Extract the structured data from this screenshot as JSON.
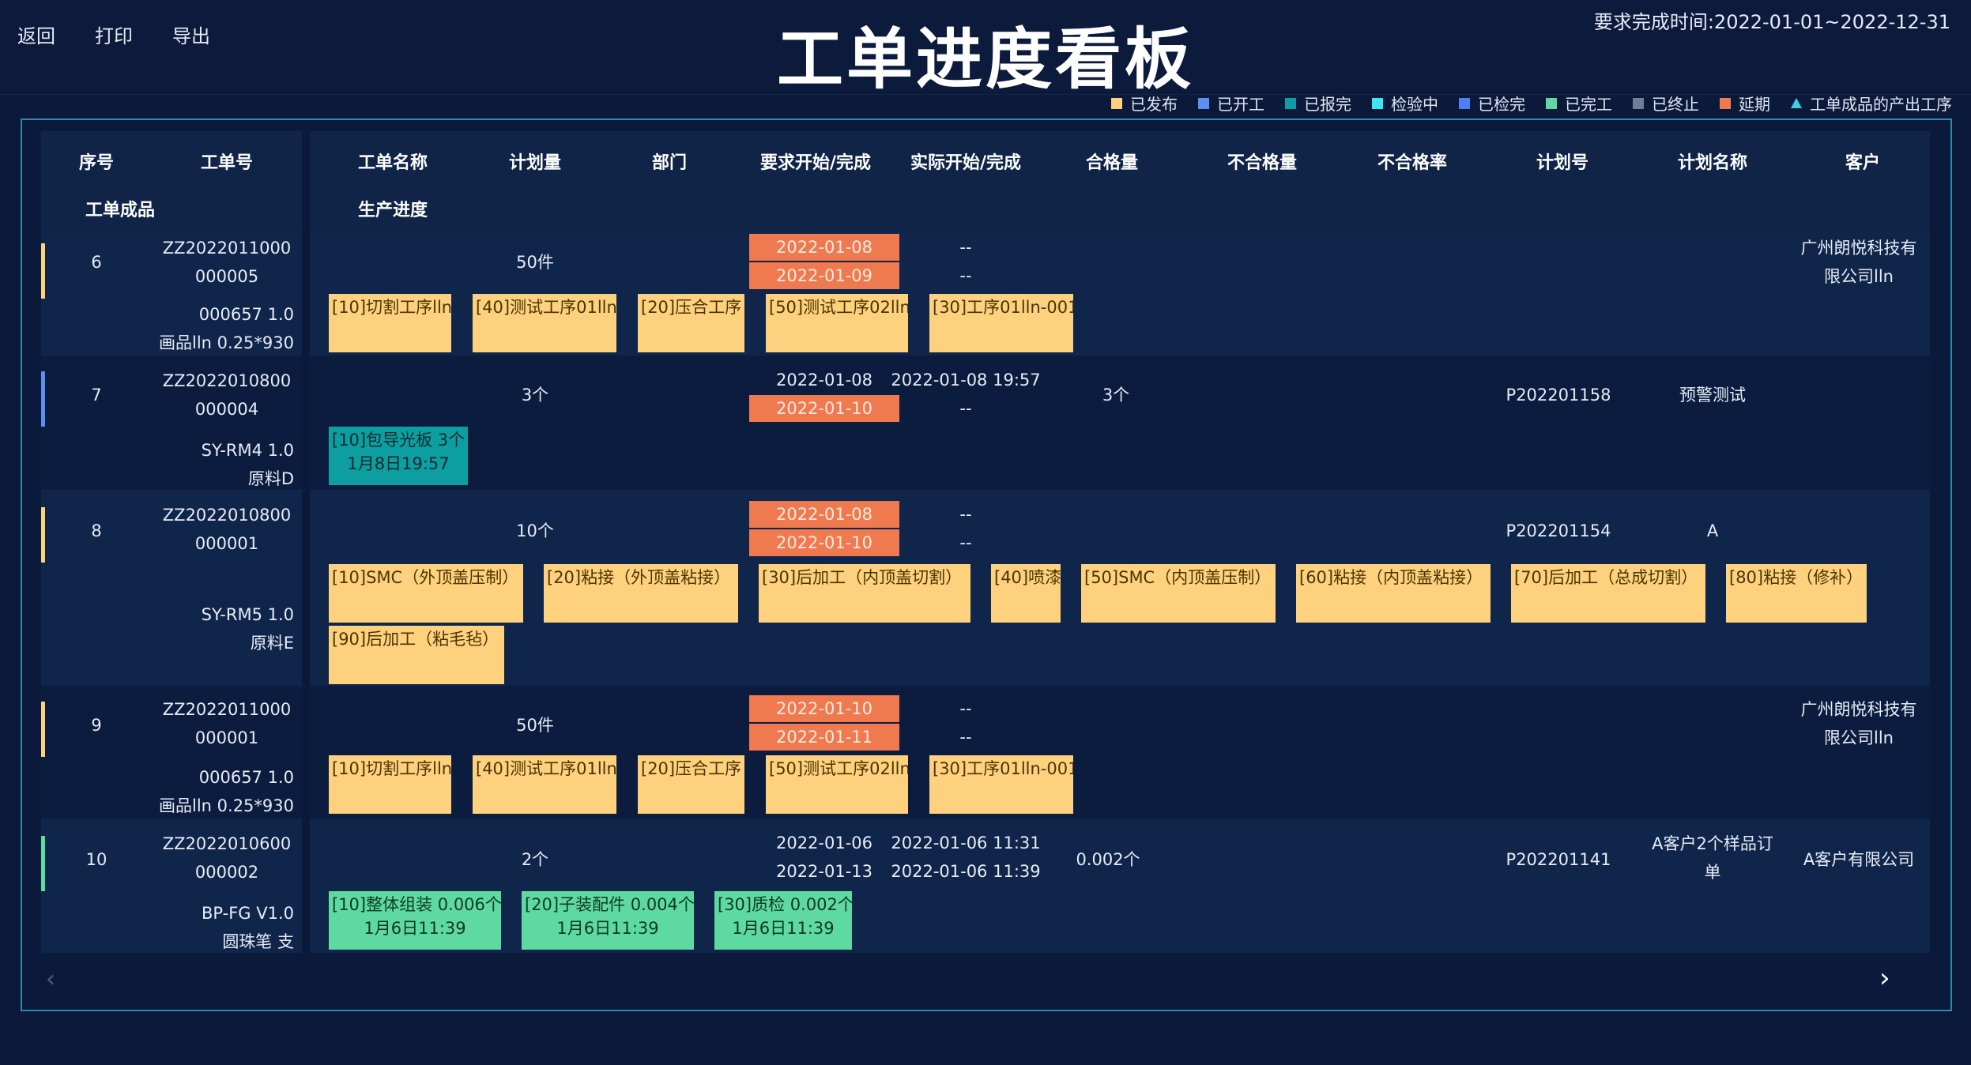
{
  "header": {
    "nav": [
      "返回",
      "打印",
      "导出"
    ],
    "title": "工单进度看板",
    "due_range": "要求完成时间:2022-01-01~2022-12-31"
  },
  "legend": [
    {
      "label": "已发布",
      "color": "#fdd17e"
    },
    {
      "label": "已开工",
      "color": "#5b8ff0"
    },
    {
      "label": "已报完",
      "color": "#0c9ea1"
    },
    {
      "label": "检验中",
      "color": "#3ae6f0"
    },
    {
      "label": "已检完",
      "color": "#4f7ff5"
    },
    {
      "label": "已完工",
      "color": "#5fd9a2"
    },
    {
      "label": "已终止",
      "color": "#6f7d96"
    },
    {
      "label": "延期",
      "color": "#ef7a4f"
    },
    {
      "label": "工单成品的产出工序",
      "color": "#3ad1e8"
    }
  ],
  "columns": {
    "seq": "序号",
    "wo_no": "工单号",
    "product": "工单成品",
    "wo_name": "工单名称",
    "progress": "生产进度",
    "plan_qty": "计划量",
    "dept": "部门",
    "req": "要求开始/完成",
    "actual": "实际开始/完成",
    "pass": "合格量",
    "fail": "不合格量",
    "fail_rate": "不合格率",
    "plan_no": "计划号",
    "plan_name": "计划名称",
    "customer": "客户"
  },
  "rows": [
    {
      "seq": "6",
      "wo_no_1": "ZZ2022011000",
      "wo_no_2": "000005",
      "product_1": "000657  1.0",
      "product_2": "画品lln  0.25*930",
      "status_color": "#fdd17e",
      "plan_qty": "50件",
      "req_start": "2022-01-08",
      "req_end": "2022-01-09",
      "act_start": "--",
      "act_end": "--",
      "pass": "",
      "plan_no": "",
      "plan_name": "",
      "customer_1": "广州朗悦科技有",
      "customer_2": "限公司lln",
      "procs": [
        {
          "text": "[10]切割工序lln",
          "sub": ""
        },
        {
          "text": "[40]测试工序01lln",
          "sub": ""
        },
        {
          "text": "[20]压合工序",
          "sub": ""
        },
        {
          "text": "[50]测试工序02lln",
          "sub": ""
        },
        {
          "text": "[30]工序01lln-001",
          "sub": ""
        }
      ]
    },
    {
      "seq": "7",
      "wo_no_1": "ZZ2022010800",
      "wo_no_2": "000004",
      "product_1": "SY-RM4  1.0",
      "product_2": "原料D",
      "status_color": "#5b8ff0",
      "plan_qty": "3个",
      "req_start": "2022-01-08",
      "req_end": "2022-01-10",
      "act_start": "2022-01-08 19:57",
      "act_end": "--",
      "pass": "3个",
      "plan_no": "P202201158",
      "plan_name": "预警测试",
      "customer_1": "",
      "customer_2": "",
      "procs": [
        {
          "text": "[10]包导光板  3个",
          "sub": "1月8日19:57"
        }
      ]
    },
    {
      "seq": "8",
      "wo_no_1": "ZZ2022010800",
      "wo_no_2": "000001",
      "product_1": "SY-RM5  1.0",
      "product_2": "原料E",
      "status_color": "#fdd17e",
      "plan_qty": "10个",
      "req_start": "2022-01-08",
      "req_end": "2022-01-10",
      "act_start": "--",
      "act_end": "--",
      "pass": "",
      "plan_no": "P202201154",
      "plan_name": "A",
      "customer_1": "",
      "customer_2": "",
      "procs": [
        {
          "text": "[10]SMC（外顶盖压制）",
          "sub": ""
        },
        {
          "text": "[20]粘接（外顶盖粘接）",
          "sub": ""
        },
        {
          "text": "[30]后加工（内顶盖切割）",
          "sub": ""
        },
        {
          "text": "[40]喷漆",
          "sub": ""
        },
        {
          "text": "[50]SMC（内顶盖压制）",
          "sub": ""
        },
        {
          "text": "[60]粘接（内顶盖粘接）",
          "sub": ""
        },
        {
          "text": "[70]后加工（总成切割）",
          "sub": ""
        },
        {
          "text": "[80]粘接（修补）",
          "sub": ""
        },
        {
          "text": "[90]后加工（粘毛毡）",
          "sub": ""
        }
      ]
    },
    {
      "seq": "9",
      "wo_no_1": "ZZ2022011000",
      "wo_no_2": "000001",
      "product_1": "000657  1.0",
      "product_2": "画品lln  0.25*930",
      "status_color": "#fdd17e",
      "plan_qty": "50件",
      "req_start": "2022-01-10",
      "req_end": "2022-01-11",
      "act_start": "--",
      "act_end": "--",
      "pass": "",
      "plan_no": "",
      "plan_name": "",
      "customer_1": "广州朗悦科技有",
      "customer_2": "限公司lln",
      "procs": [
        {
          "text": "[10]切割工序lln",
          "sub": ""
        },
        {
          "text": "[40]测试工序01lln",
          "sub": ""
        },
        {
          "text": "[20]压合工序",
          "sub": ""
        },
        {
          "text": "[50]测试工序02lln",
          "sub": ""
        },
        {
          "text": "[30]工序01lln-001",
          "sub": ""
        }
      ]
    },
    {
      "seq": "10",
      "wo_no_1": "ZZ2022010600",
      "wo_no_2": "000002",
      "product_1": "BP-FG  V1.0",
      "product_2": "圆珠笔  支",
      "status_color": "#5fd9a2",
      "plan_qty": "2个",
      "req_start": "2022-01-06",
      "req_end": "2022-01-13",
      "act_start": "2022-01-06 11:31",
      "act_end": "2022-01-06 11:39",
      "pass": "0.002个",
      "plan_no": "P202201141",
      "plan_name_1": "A客户2个样品订",
      "plan_name_2": "单",
      "customer_1": "A客户有限公司",
      "customer_2": "",
      "procs": [
        {
          "text": "[10]整体组装  0.006个",
          "sub": "1月6日11:39"
        },
        {
          "text": "[20]子装配件  0.004个",
          "sub": "1月6日11:39"
        },
        {
          "text": "[30]质检  0.002个",
          "sub": "1月6日11:39"
        }
      ]
    }
  ],
  "scroll": {
    "left_icon": "chevron-left-icon",
    "right_icon": "chevron-right-icon"
  }
}
